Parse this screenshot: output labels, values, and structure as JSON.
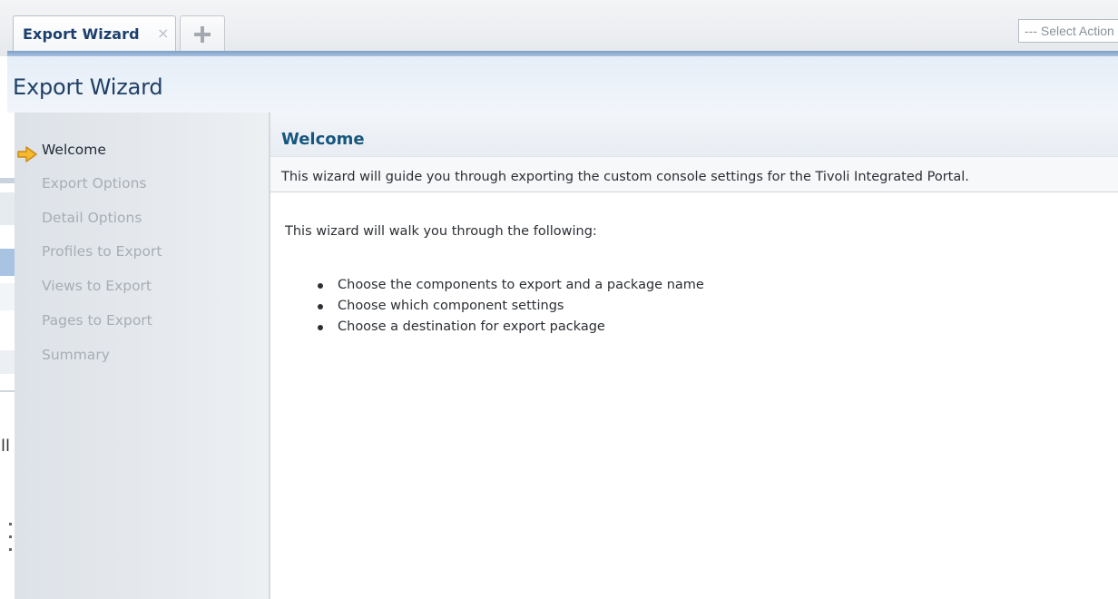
{
  "tabbar": {
    "active_tab_label": "Export Wizard",
    "close_glyph": "×",
    "add_tab_icon": "plus-icon",
    "select_action_placeholder": "--- Select Action ---"
  },
  "page": {
    "title": "Export Wizard"
  },
  "sliver": {
    "text_a": "ll"
  },
  "steps": {
    "current_icon": "arrow-right-icon",
    "items": [
      {
        "label": "Welcome",
        "current": true
      },
      {
        "label": "Export Options",
        "current": false
      },
      {
        "label": "Detail Options",
        "current": false
      },
      {
        "label": "Profiles to Export",
        "current": false
      },
      {
        "label": "Views to Export",
        "current": false
      },
      {
        "label": "Pages to Export",
        "current": false
      },
      {
        "label": "Summary",
        "current": false
      }
    ]
  },
  "content": {
    "title": "Welcome",
    "subtitle": "This wizard will guide you through exporting the custom console settings for the Tivoli Integrated Portal.",
    "intro": "This wizard will walk you through the following:",
    "bullets": [
      "Choose the components to export and a package name",
      "Choose which component settings",
      "Choose a destination for export package"
    ]
  },
  "colors": {
    "accent_title": "#17567e",
    "header_text": "#1e3f66",
    "step_current": "#1f2a36",
    "step_inactive": "#a6adb5",
    "arrow_fill": "#f5b82e"
  }
}
